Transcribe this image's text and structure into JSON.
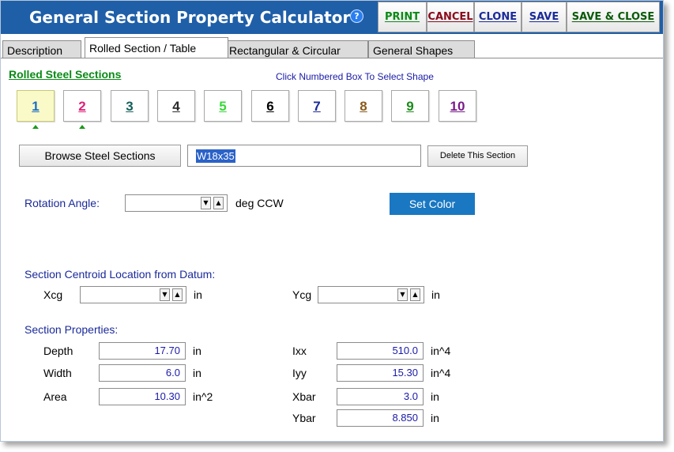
{
  "title": "General Section Property Calculator",
  "help_label": "?",
  "toolbar": {
    "print": "PRINT",
    "cancel": "CANCEL",
    "clone": "CLONE",
    "save": "SAVE",
    "save_close": "SAVE & CLOSE"
  },
  "tabs": [
    "Description",
    "Rolled Section / Table",
    "Rectangular & Circular",
    "General Shapes"
  ],
  "active_tab": "Rolled Section / Table",
  "section_title": "Rolled Steel Sections",
  "hint": "Click Numbered Box To Select Shape",
  "shape_boxes": [
    {
      "label": "1",
      "color": "#1a6fc4",
      "selected": true,
      "marker": true
    },
    {
      "label": "2",
      "color": "#e0207a",
      "selected": false,
      "marker": true
    },
    {
      "label": "3",
      "color": "#145f5a",
      "selected": false,
      "marker": false
    },
    {
      "label": "4",
      "color": "#2a2a2a",
      "selected": false,
      "marker": false
    },
    {
      "label": "5",
      "color": "#38d838",
      "selected": false,
      "marker": false
    },
    {
      "label": "6",
      "color": "#000000",
      "selected": false,
      "marker": false
    },
    {
      "label": "7",
      "color": "#1a2a9a",
      "selected": false,
      "marker": false
    },
    {
      "label": "8",
      "color": "#8a5a1a",
      "selected": false,
      "marker": false
    },
    {
      "label": "9",
      "color": "#1a8a1a",
      "selected": false,
      "marker": false
    },
    {
      "label": "10",
      "color": "#7a1a8a",
      "selected": false,
      "marker": false
    }
  ],
  "browse_button": "Browse Steel Sections",
  "section_name": "W18x35",
  "delete_button": "Delete This Section",
  "rotation": {
    "label": "Rotation Angle:",
    "value": "",
    "unit": "deg CCW"
  },
  "set_color_button": "Set Color",
  "set_color_bg": "#1a78c2",
  "centroid": {
    "title": "Section Centroid Location from Datum:",
    "xcg_label": "Xcg",
    "xcg_value": "",
    "xcg_unit": "in",
    "ycg_label": "Ycg",
    "ycg_value": "",
    "ycg_unit": "in"
  },
  "properties": {
    "title": "Section Properties:",
    "left": [
      {
        "label": "Depth",
        "value": "17.70",
        "unit": "in"
      },
      {
        "label": "Width",
        "value": "6.0",
        "unit": "in"
      },
      {
        "label": "Area",
        "value": "10.30",
        "unit": "in^2"
      }
    ],
    "right": [
      {
        "label": "Ixx",
        "value": "510.0",
        "unit": "in^4"
      },
      {
        "label": "Iyy",
        "value": "15.30",
        "unit": "in^4"
      },
      {
        "label": "Xbar",
        "value": "3.0",
        "unit": "in"
      },
      {
        "label": "Ybar",
        "value": "8.850",
        "unit": "in"
      }
    ]
  }
}
